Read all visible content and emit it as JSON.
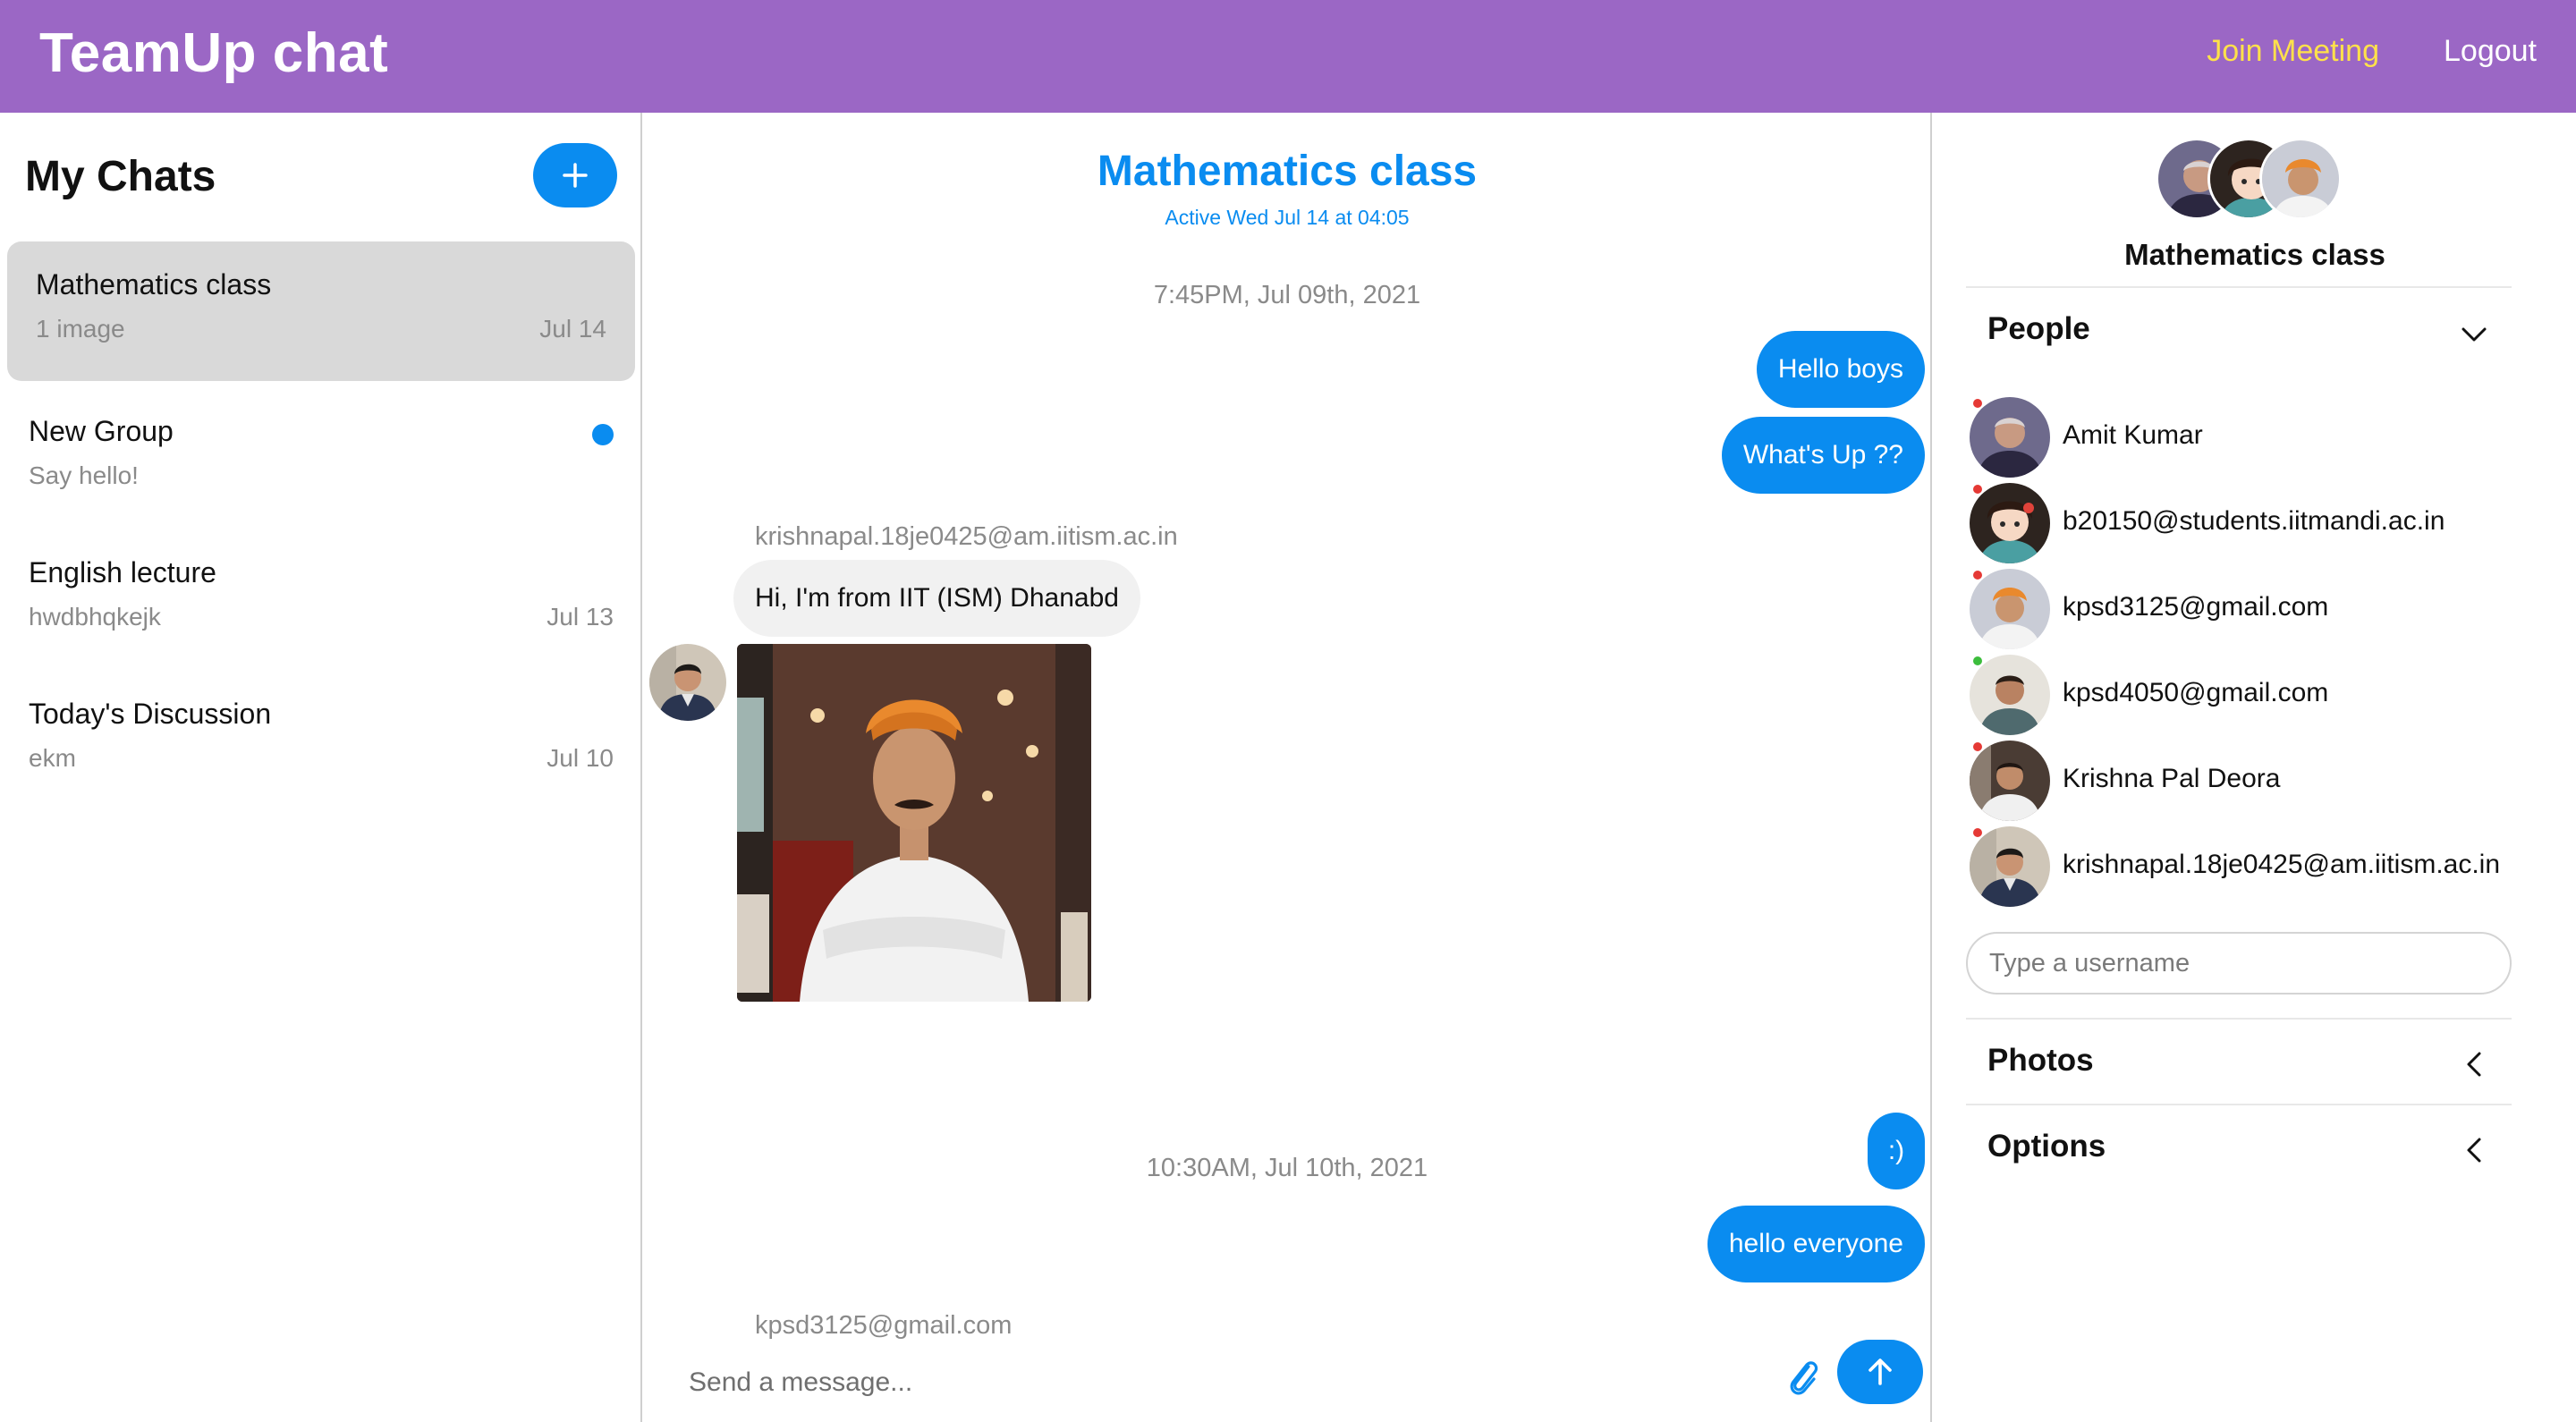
{
  "topbar": {
    "title": "TeamUp chat",
    "join_meeting": "Join Meeting",
    "logout": "Logout"
  },
  "chat_list": {
    "title": "My Chats",
    "new_chat_icon": "plus-icon",
    "items": [
      {
        "name": "Mathematics class",
        "preview": "1 image",
        "date": "Jul 14",
        "active": true,
        "unread": false
      },
      {
        "name": "New Group",
        "preview": "Say hello!",
        "date": "",
        "active": false,
        "unread": true
      },
      {
        "name": "English lecture",
        "preview": "hwdbhqkejk",
        "date": "Jul 13",
        "active": false,
        "unread": false
      },
      {
        "name": "Today's Discussion",
        "preview": "ekm",
        "date": "Jul 10",
        "active": false,
        "unread": false
      }
    ]
  },
  "feed": {
    "title": "Mathematics class",
    "subtitle": "Active Wed Jul 14 at 04:05",
    "timestamps": [
      "7:45PM, Jul 09th, 2021",
      "10:30AM, Jul 10th, 2021"
    ],
    "messages": {
      "m1": "Hello boys",
      "m2": "What's Up ??",
      "m3_sender": "krishnapal.18je0425@am.iitism.ac.in",
      "m3": "Hi, I'm from IIT (ISM) Dhanabd",
      "m4": ":)",
      "m5": "hello everyone",
      "m6_sender": "kpsd3125@gmail.com"
    },
    "composer_placeholder": "Send a message...",
    "attach_icon": "paperclip-icon",
    "send_icon": "arrow-up-icon"
  },
  "settings": {
    "title": "Mathematics class",
    "people_label": "People",
    "people": [
      {
        "name": "Amit Kumar",
        "online": false
      },
      {
        "name": "b20150@students.iitmandi.ac.in",
        "online": false
      },
      {
        "name": "kpsd3125@gmail.com",
        "online": false
      },
      {
        "name": "kpsd4050@gmail.com",
        "online": true
      },
      {
        "name": "Krishna Pal Deora",
        "online": false
      },
      {
        "name": "krishnapal.18je0425@am.iitism.ac.in",
        "online": false
      }
    ],
    "username_placeholder": "Type a username",
    "photos_label": "Photos",
    "options_label": "Options"
  },
  "colors": {
    "brand": "#9b67c5",
    "accent": "#0a8cf0",
    "join_link": "#ffe14a",
    "online": "#3cbd3c",
    "offline": "#e53935"
  }
}
